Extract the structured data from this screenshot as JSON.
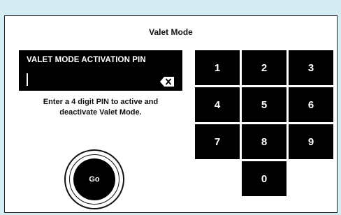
{
  "title": "Valet Mode",
  "pin_field": {
    "label": "VALET MODE ACTIVATION PIN",
    "value": ""
  },
  "instructions": {
    "line1": "Enter a 4 digit PIN to active and",
    "line2": "deactivate Valet Mode."
  },
  "go_button": {
    "label": "Go"
  },
  "keypad": {
    "k1": "1",
    "k2": "2",
    "k3": "3",
    "k4": "4",
    "k5": "5",
    "k6": "6",
    "k7": "7",
    "k8": "8",
    "k9": "9",
    "k0": "0"
  },
  "colors": {
    "background": "#d6ecf3",
    "panel": "#ffffff",
    "key": "#000000"
  }
}
